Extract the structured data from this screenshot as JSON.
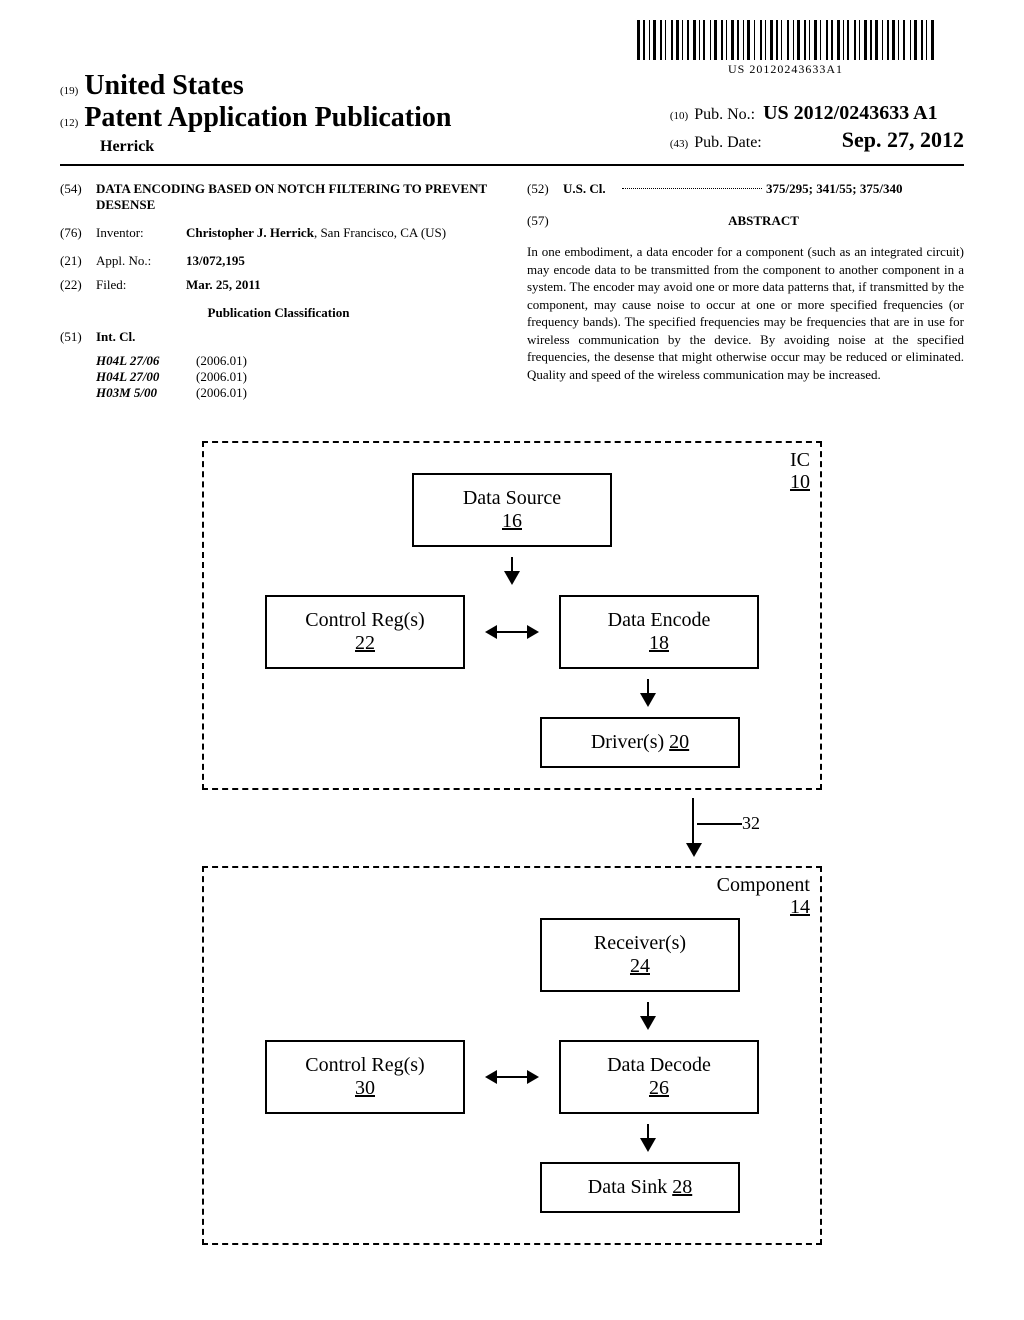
{
  "barcode_text": "US 20120243633A1",
  "header": {
    "num19": "(19)",
    "country": "United States",
    "num12": "(12)",
    "pub_type": "Patent Application Publication",
    "author": "Herrick",
    "num10": "(10)",
    "pub_no_label": "Pub. No.:",
    "pub_no": "US 2012/0243633 A1",
    "num43": "(43)",
    "pub_date_label": "Pub. Date:",
    "pub_date": "Sep. 27, 2012"
  },
  "left_col": {
    "num54": "(54)",
    "title": "DATA ENCODING BASED ON NOTCH FILTERING TO PREVENT DESENSE",
    "num76": "(76)",
    "inventor_label": "Inventor:",
    "inventor": "Christopher J. Herrick",
    "inventor_loc": ", San Francisco, CA (US)",
    "num21": "(21)",
    "appl_label": "Appl. No.:",
    "appl_no": "13/072,195",
    "num22": "(22)",
    "filed_label": "Filed:",
    "filed_date": "Mar. 25, 2011",
    "class_title": "Publication Classification",
    "num51": "(51)",
    "intcl_label": "Int. Cl.",
    "intcl": [
      {
        "code": "H04L 27/06",
        "year": "(2006.01)"
      },
      {
        "code": "H04L 27/00",
        "year": "(2006.01)"
      },
      {
        "code": "H03M 5/00",
        "year": "(2006.01)"
      }
    ]
  },
  "right_col": {
    "num52": "(52)",
    "uscl_label": "U.S. Cl.",
    "uscl_val": "375/295; 341/55; 375/340",
    "num57": "(57)",
    "abstract_title": "ABSTRACT",
    "abstract": "In one embodiment, a data encoder for a component (such as an integrated circuit) may encode data to be transmitted from the component to another component in a system. The encoder may avoid one or more data patterns that, if transmitted by the component, may cause noise to occur at one or more specified frequencies (or frequency bands). The specified frequencies may be frequencies that are in use for wireless communication by the device. By avoiding noise at the specified frequencies, the desense that might otherwise occur may be reduced or eliminated. Quality and speed of the wireless communication may be increased."
  },
  "diagram": {
    "ic_label": "IC",
    "ic_num": "10",
    "data_source": "Data Source",
    "data_source_num": "16",
    "control_reg1": "Control Reg(s)",
    "control_reg1_num": "22",
    "data_encode": "Data Encode",
    "data_encode_num": "18",
    "drivers": "Driver(s)",
    "drivers_num": "20",
    "interconnect_num": "32",
    "component_label": "Component",
    "component_num": "14",
    "receivers": "Receiver(s)",
    "receivers_num": "24",
    "control_reg2": "Control Reg(s)",
    "control_reg2_num": "30",
    "data_decode": "Data Decode",
    "data_decode_num": "26",
    "data_sink": "Data Sink",
    "data_sink_num": "28"
  }
}
